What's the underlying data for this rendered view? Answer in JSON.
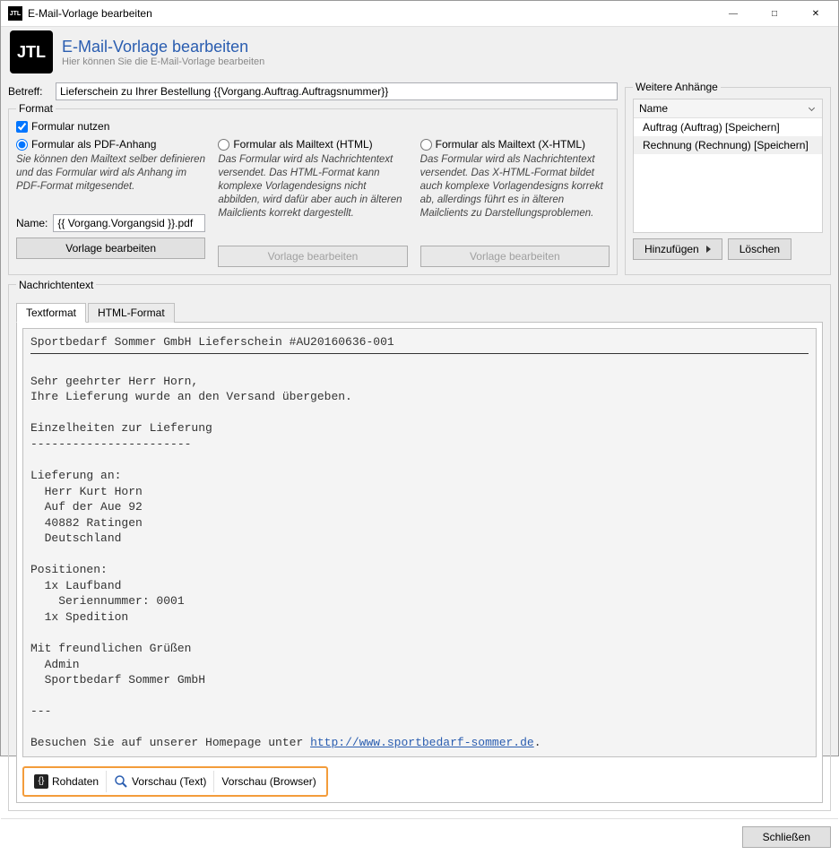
{
  "window": {
    "title": "E-Mail-Vorlage bearbeiten"
  },
  "header": {
    "logo_text": "JTL",
    "title": "E-Mail-Vorlage bearbeiten",
    "subtitle": "Hier können Sie die E-Mail-Vorlage bearbeiten"
  },
  "subject": {
    "label": "Betreff:",
    "value": "Lieferschein zu Ihrer Bestellung {{Vorgang.Auftrag.Auftragsnummer}}"
  },
  "format": {
    "legend": "Format",
    "use_form_label": "Formular nutzen",
    "use_form_checked": true,
    "columns": [
      {
        "radio_label": "Formular als PDF-Anhang",
        "radio_checked": true,
        "desc": "Sie können den Mailtext selber definieren und das Formular wird als Anhang im PDF-Format mitgesendet.",
        "name_label": "Name:",
        "name_value": "{{ Vorgang.Vorgangsid }}.pdf",
        "edit_button": "Vorlage bearbeiten",
        "edit_enabled": true
      },
      {
        "radio_label": "Formular als Mailtext (HTML)",
        "radio_checked": false,
        "desc": "Das Formular wird als Nachrichtentext versendet. Das HTML-Format kann komplexe Vorlagendesigns nicht abbilden, wird dafür aber auch in älteren Mailclients korrekt dargestellt.",
        "edit_button": "Vorlage bearbeiten",
        "edit_enabled": false
      },
      {
        "radio_label": "Formular als Mailtext (X-HTML)",
        "radio_checked": false,
        "desc": "Das Formular wird als Nachrichtentext versendet. Das X-HTML-Format bildet auch komplexe Vorlagendesigns korrekt ab, allerdings führt es in älteren Mailclients zu Darstellungsproblemen.",
        "edit_button": "Vorlage bearbeiten",
        "edit_enabled": false
      }
    ]
  },
  "attachments": {
    "legend": "Weitere Anhänge",
    "header": "Name",
    "items": [
      "Auftrag (Auftrag) [Speichern]",
      "Rechnung (Rechnung) [Speichern]"
    ],
    "add_button": "Hinzufügen",
    "delete_button": "Löschen"
  },
  "message": {
    "legend": "Nachrichtentext",
    "tabs": [
      "Textformat",
      "HTML-Format"
    ],
    "active_tab": 0,
    "body_line1": "Sportbedarf Sommer GmbH Lieferschein #AU20160636-001",
    "body_rest": "\nSehr geehrter Herr Horn,\nIhre Lieferung wurde an den Versand übergeben.\n\nEinzelheiten zur Lieferung\n-----------------------\n\nLieferung an:\n  Herr Kurt Horn\n  Auf der Aue 92\n  40882 Ratingen\n  Deutschland\n\nPositionen:\n  1x Laufband\n    Seriennummer: 0001\n  1x Spedition\n\nMit freundlichen Grüßen\n  Admin\n  Sportbedarf Sommer GmbH\n\n---\n\nBesuchen Sie auf unserer Homepage unter ",
    "body_link": "http://www.sportbedarf-sommer.de",
    "body_tail": ".",
    "bottom_tabs": [
      "Rohdaten",
      "Vorschau (Text)",
      "Vorschau (Browser)"
    ]
  },
  "footer": {
    "close_button": "Schließen"
  }
}
